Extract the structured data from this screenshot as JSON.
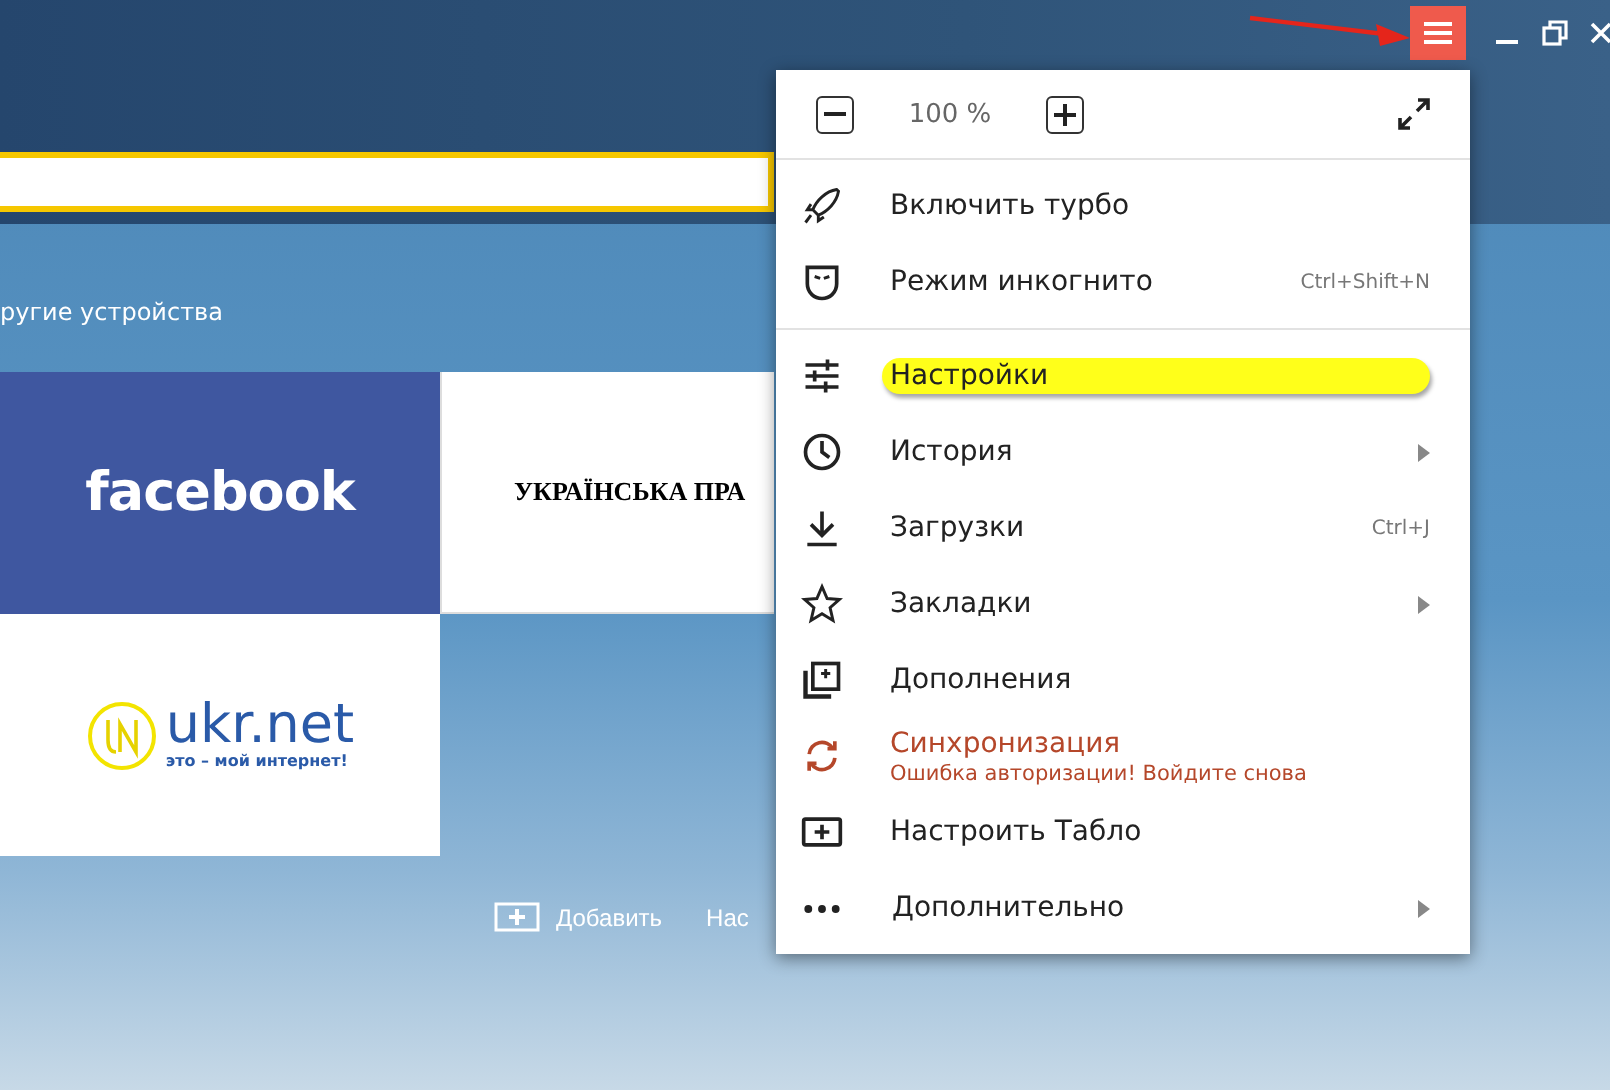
{
  "titlebar": {
    "menu_open": true
  },
  "sync_link": "ругие устройства",
  "tiles": [
    {
      "kind": "facebook",
      "label": "facebook"
    },
    {
      "kind": "ukrpravda",
      "label": "УКРАЇНСЬКА ПРА"
    },
    {
      "kind": "ukrnet",
      "label": "ukr.net",
      "tagline": "это – мой интернет!"
    }
  ],
  "tile_actions": [
    {
      "kind": "add",
      "label": "Добавить"
    },
    {
      "kind": "text",
      "label": "Нас"
    }
  ],
  "menu": {
    "zoom": "100 %",
    "sections": [
      {
        "items": [
          {
            "kind": "turbo",
            "label": "Включить турбо",
            "highlighted": false,
            "submenu": false
          },
          {
            "kind": "incognito",
            "label": "Режим инкогнито",
            "shortcut": "Ctrl+Shift+N",
            "highlighted": false,
            "submenu": false
          }
        ]
      },
      {
        "items": [
          {
            "kind": "settings",
            "label": "Настройки",
            "highlighted": true,
            "submenu": false
          },
          {
            "kind": "history",
            "label": "История",
            "highlighted": false,
            "submenu": true
          },
          {
            "kind": "downloads",
            "label": "Загрузки",
            "shortcut": "Ctrl+J",
            "highlighted": false,
            "submenu": false
          },
          {
            "kind": "bookmarks",
            "label": "Закладки",
            "highlighted": false,
            "submenu": true
          },
          {
            "kind": "addons",
            "label": "Дополнения",
            "highlighted": false,
            "submenu": false
          },
          {
            "kind": "sync",
            "label": "Синхронизация",
            "alert": "Ошибка авторизации! Войдите снова",
            "highlighted": false,
            "submenu": false
          },
          {
            "kind": "tablo",
            "label": "Настроить Табло",
            "highlighted": false,
            "submenu": false
          },
          {
            "kind": "more",
            "label": "Дополнительно",
            "highlighted": false,
            "submenu": true
          }
        ]
      }
    ]
  }
}
